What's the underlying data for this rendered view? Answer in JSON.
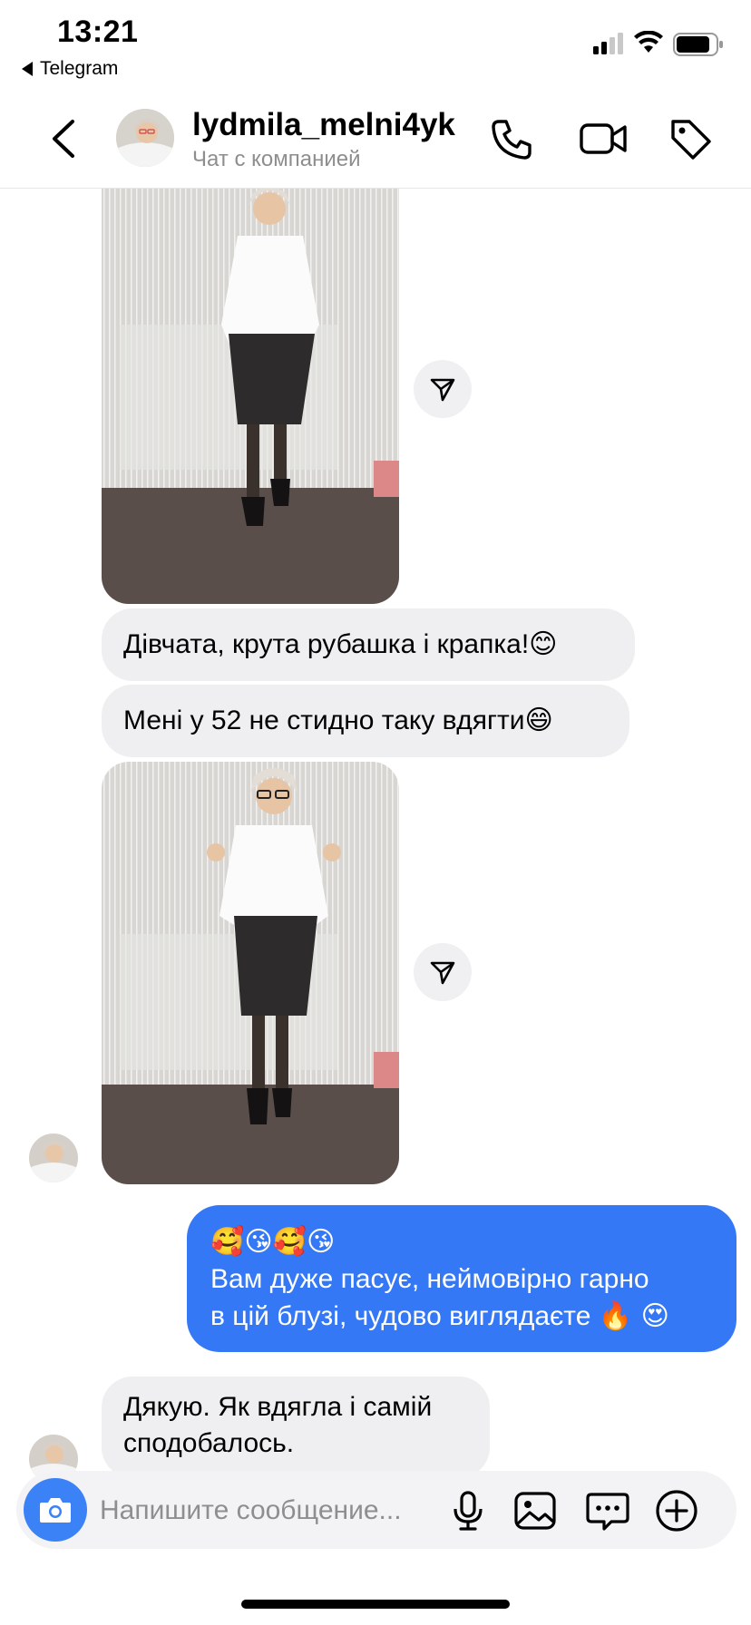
{
  "status_bar": {
    "time": "13:21",
    "back_app": "Telegram"
  },
  "header": {
    "username": "lydmila_melni4yk",
    "subtitle": "Чат с компанией",
    "icons": [
      "back-chevron-icon",
      "phone-icon",
      "video-camera-icon",
      "tag-icon"
    ]
  },
  "messages": [
    {
      "type": "photo",
      "from": "them",
      "caption": ""
    },
    {
      "type": "text",
      "from": "them",
      "text": "Дівчата, крута рубашка і крапка!",
      "emoji": "😊"
    },
    {
      "type": "text",
      "from": "them",
      "text": "Мені у 52 не стидно таку вдягти",
      "emoji": "😄"
    },
    {
      "type": "photo",
      "from": "them",
      "caption": ""
    },
    {
      "type": "text",
      "from": "me",
      "emoji_line": "🥰😘🥰😘",
      "line1": "Вам дуже пасує, неймовірно гарно",
      "line2": "в цій блузі, чудово виглядаєте ",
      "line2_emoji": "🔥 😍"
    },
    {
      "type": "text",
      "from": "them",
      "line1": "Дякую. Як вдягла і самій",
      "line2": "сподобалось."
    }
  ],
  "composer": {
    "placeholder": "Напишите сообщение...",
    "value": ""
  },
  "colors": {
    "outgoing_bubble": "#3478f6",
    "incoming_bubble": "#efeff1",
    "camera_button": "#3b82f6"
  }
}
